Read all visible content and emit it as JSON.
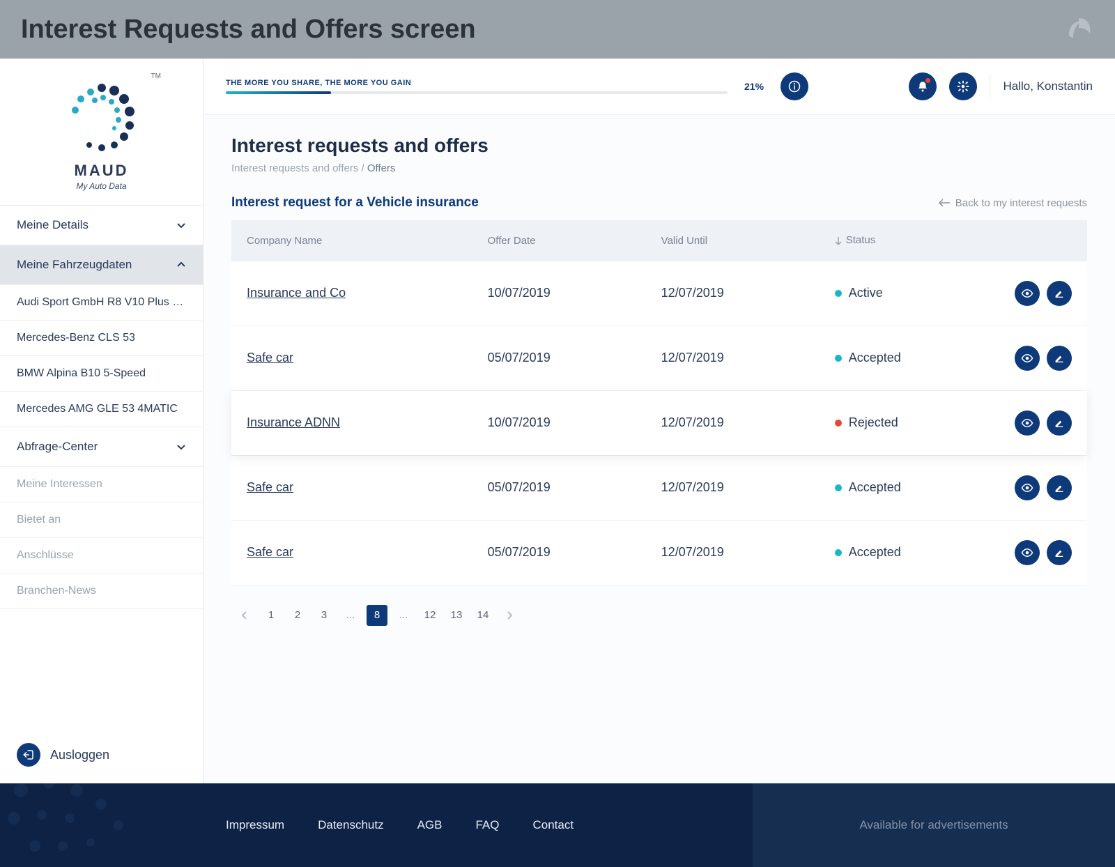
{
  "outer": {
    "title": "Interest Requests and Offers screen"
  },
  "brand": {
    "name": "MAUD",
    "tagline": "My Auto Data",
    "tm": "TM"
  },
  "sidebar": {
    "items": [
      {
        "label": "Meine Details",
        "type": "group",
        "expanded": false
      },
      {
        "label": "Meine Fahrzeugdaten",
        "type": "group",
        "expanded": true
      },
      {
        "label": "Audi Sport GmbH R8 V10 Plus Sp...",
        "type": "sub"
      },
      {
        "label": "Mercedes-Benz CLS 53",
        "type": "sub"
      },
      {
        "label": "BMW Alpina B10 5-Speed",
        "type": "sub"
      },
      {
        "label": "Mercedes AMG GLE 53 4MATIC",
        "type": "sub"
      },
      {
        "label": "Abfrage-Center",
        "type": "group",
        "expanded": false
      },
      {
        "label": "Meine Interessen",
        "type": "sub",
        "muted": true
      },
      {
        "label": "Bietet an",
        "type": "sub",
        "muted": true
      },
      {
        "label": "Anschlüsse",
        "type": "sub",
        "muted": true
      },
      {
        "label": "Branchen-News",
        "type": "sub",
        "muted": true
      }
    ],
    "logout": "Ausloggen"
  },
  "topbar": {
    "progress_label": "THE MORE YOU SHARE, THE MORE YOU GAIN",
    "progress_pct": "21%",
    "greeting": "Hallo, Konstantin"
  },
  "page": {
    "title": "Interest requests and offers",
    "breadcrumb_root": "Interest requests and offers",
    "breadcrumb_sep": " / ",
    "breadcrumb_current": "Offers",
    "section_title": "Interest request for a Vehicle insurance",
    "back_link": "Back to my interest requests"
  },
  "table": {
    "headers": {
      "company": "Company Name",
      "date": "Offer Date",
      "valid": "Valid Until",
      "status": "Status"
    },
    "rows": [
      {
        "company": "Insurance and Co",
        "date": "10/07/2019",
        "valid": "12/07/2019",
        "status": "Active",
        "status_key": "active",
        "highlight": false
      },
      {
        "company": "Safe car",
        "date": "05/07/2019",
        "valid": "12/07/2019",
        "status": "Accepted",
        "status_key": "accepted",
        "highlight": false
      },
      {
        "company": "Insurance ADNN",
        "date": "10/07/2019",
        "valid": "12/07/2019",
        "status": "Rejected",
        "status_key": "rejected",
        "highlight": true
      },
      {
        "company": "Safe car",
        "date": "05/07/2019",
        "valid": "12/07/2019",
        "status": "Accepted",
        "status_key": "accepted",
        "highlight": false
      },
      {
        "company": "Safe car",
        "date": "05/07/2019",
        "valid": "12/07/2019",
        "status": "Accepted",
        "status_key": "accepted",
        "highlight": false
      }
    ]
  },
  "pagination": {
    "pages": [
      "1",
      "2",
      "3",
      "...",
      "8",
      "...",
      "12",
      "13",
      "14"
    ],
    "current": "8"
  },
  "footer": {
    "links": [
      "Impressum",
      "Datenschutz",
      "AGB",
      "FAQ",
      "Contact"
    ],
    "ad_text": "Available for advertisements"
  }
}
